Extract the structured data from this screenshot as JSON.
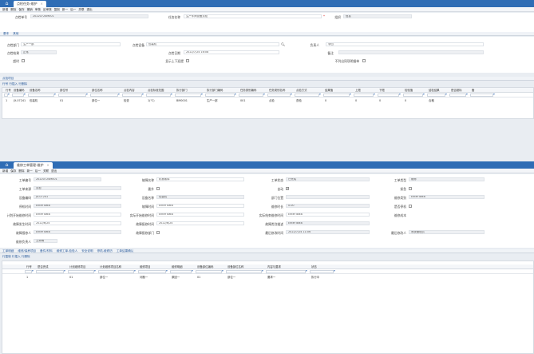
{
  "window1": {
    "tab_label": "点检任务-维护",
    "toolbar": [
      "新增",
      "删除",
      "保存",
      "撤销",
      "审核",
      "反审核",
      "复制",
      "新一",
      "后一",
      "关联",
      "退出"
    ],
    "form": {
      "task_no_label": "点检单号",
      "task_no_value": "20220724M001",
      "task_name_label": "任务名称",
      "task_name_value": "生产车间设备点检",
      "org_label": "组织",
      "org_value": "信息",
      "basic_tab": "基本",
      "other_tab": "其他",
      "dept_label": "点检部门",
      "dept_value": "生产一部",
      "device_label": "点检设备",
      "device_value": "包装机",
      "owner_label": "负责人",
      "owner_value": "李四",
      "result_label": "点检结果",
      "result_value": "正常",
      "plan_date_label": "点检日期",
      "plan_date_value": "2022/7/24 16:08",
      "remark_label": "备注",
      "overdue_label": "超时",
      "show_ok_label": "显示上下班提",
      "notice_label": "不列出同项明细单"
    },
    "grid": {
      "section_label": "点检项目",
      "actions": "行号 行插入 行删除",
      "headers": [
        "行号",
        "设备编码",
        "设备名称",
        "部位号",
        "部位名称",
        "点检内容",
        "点检标准范围",
        "执行部门",
        "执行部门编码",
        "任务类别编码",
        "任务类别名称",
        "点检方式",
        "结果值",
        "上限",
        "下限",
        "检验值",
        "结检结果",
        "是否超标",
        "备"
      ],
      "row": [
        "1",
        "JX-07241",
        "包装机",
        "01",
        "部位一",
        "检查",
        "1(℃)",
        "BM0001",
        "生产一部",
        "001",
        "点检",
        "查验",
        "0",
        "0",
        "0",
        "0",
        "合格",
        "",
        ""
      ]
    }
  },
  "window2": {
    "tab_label": "维修工单管理-维护",
    "toolbar": [
      "新增",
      "保存",
      "删除",
      "新一",
      "后一",
      "关联",
      "退出"
    ],
    "form": {
      "order_no_label": "工单编号",
      "order_no_value": "20220724M001",
      "fault_label": "故障名称",
      "fault_value": "机械故障",
      "status_label": "工单状态",
      "status_value": "已完成",
      "type_label": "工单类型",
      "type_value": "维修",
      "source_label": "工单来源",
      "source_value": "点检",
      "outsource_label": "委外",
      "auto_label": "自动",
      "urgent_label": "紧急",
      "device_code_label": "设备编码",
      "device_code_value": "JX-07241",
      "device_name_label": "设备名称",
      "device_name_value": "包装机",
      "dept_loc_label": "部门位置",
      "repair_category_label": "维修类别",
      "repair_category_value": "Enter data",
      "maint_time_label": "停机时间",
      "maint_time_value": "Enter data",
      "fault_time_label": "故障时间",
      "fault_time_value": "Enter data",
      "repair_hours_label": "维修时长",
      "repair_hours_value": "0.00",
      "has_stop_label": "是否停机",
      "plan_start_label": "计划开始维修时间",
      "plan_start_value": "Enter data",
      "actual_start_label": "实际开始维修时间",
      "actual_start_value": "Enter data",
      "actual_end_label": "实际结束维修时间",
      "actual_end_value": "Enter data",
      "repair_cost_label": "维修成本",
      "req_date_label": "故障发生时间",
      "req_date_value": "2022/6/24",
      "report_date_label": "故障报修时间",
      "report_date_value": "2022/6/24",
      "fault_desc_label": "故障类别描述",
      "fault_desc_value": "Enter data",
      "reporter_label": "故障报修人",
      "reporter_value": "Enter data",
      "assign_label": "故障报修部门",
      "last_time_label": "最后修改时间",
      "last_time_value": "2022/7/24 11:06",
      "last_user_label": "最后修改人",
      "last_user_value": "系统管理员",
      "maintainer_label": "维修负责人",
      "maintainer_value": "王师傅"
    },
    "subtabs": [
      "工单明细",
      "维修/保养项目",
      "备件/材料",
      "维修工单-检验人",
      "安全说明",
      "停机-维修历",
      "工单结果确认"
    ],
    "grid": {
      "actions": "行复制 行插入 行删除",
      "headers": [
        "行号",
        "是否完成",
        "计划维修项目",
        "计划维修项目名称",
        "维修项目",
        "维修明细",
        "设备部位编码",
        "设备部位名称",
        "内容与要求",
        "状态"
      ],
      "row": [
        "1",
        "",
        "01",
        "部位一",
        "问题一",
        "原因一",
        "01",
        "部位一",
        "要求一",
        "执行中"
      ]
    }
  }
}
